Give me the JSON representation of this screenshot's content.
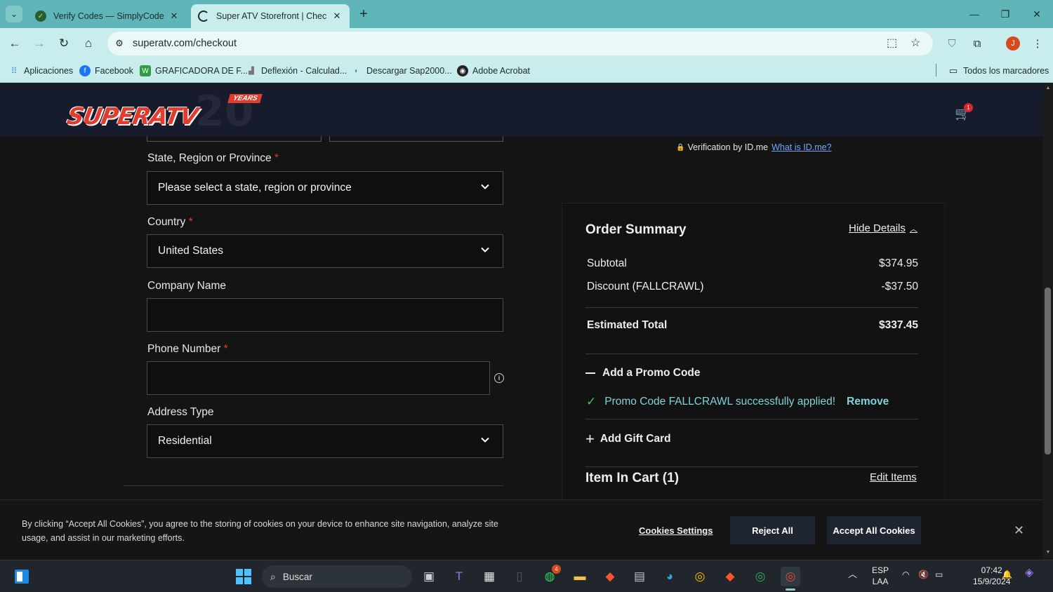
{
  "browser": {
    "tabs": [
      {
        "title": "Verify Codes — SimplyCodes",
        "active": false
      },
      {
        "title": "Super ATV Storefront | Checkou",
        "active": true
      }
    ],
    "new_tab": "+",
    "url": "superatv.com/checkout",
    "bookmarks": [
      {
        "label": "Aplicaciones",
        "icon": "apps-grid-icon",
        "color": "#4285f4"
      },
      {
        "label": "Facebook",
        "icon": "facebook-icon",
        "color": "#1877f2"
      },
      {
        "label": "GRAFICADORA DE F...",
        "icon": "graph-icon",
        "color": "#2e9c40"
      },
      {
        "label": "Deflexión - Calculad...",
        "icon": "beam-icon",
        "color": "#777777"
      },
      {
        "label": "Descargar Sap2000...",
        "icon": "download-icon",
        "color": "#3a86c8"
      },
      {
        "label": "Adobe Acrobat",
        "icon": "acrobat-icon",
        "color": "#222222"
      }
    ],
    "all_bookmarks": "Todos los marcadores",
    "profile_initial": "J"
  },
  "site": {
    "logo_text": "SUPERATV",
    "logo_anniversary": "20",
    "logo_years": "YEARS",
    "cart_count": "1"
  },
  "form": {
    "state_label": "State, Region or Province",
    "state_value": "Please select a state, region or province",
    "country_label": "Country",
    "country_value": "United States",
    "company_label": "Company Name",
    "company_value": "",
    "phone_label": "Phone Number",
    "phone_value": "",
    "address_type_label": "Address Type",
    "address_type_value": "Residential",
    "required_mark": "*"
  },
  "verification": {
    "text": "Verification by ID.me",
    "link": "What is ID.me?"
  },
  "summary": {
    "title": "Order Summary",
    "hide_details": "Hide Details",
    "subtotal_label": "Subtotal",
    "subtotal_value": "$374.95",
    "discount_label": "Discount (FALLCRAWL)",
    "discount_value": "-$37.50",
    "total_label": "Estimated Total",
    "total_value": "$337.45",
    "promo_heading": "Add a Promo Code",
    "promo_success": "Promo Code FALLCRAWL successfully applied!",
    "promo_remove": "Remove",
    "gift_card": "Add Gift Card",
    "items_title": "Item In Cart (1)",
    "edit_items": "Edit Items"
  },
  "cookie": {
    "text": "By clicking “Accept All Cookies”, you agree to the storing of cookies on your device to enhance site navigation, analyze site usage, and assist in our marketing efforts.",
    "settings": "Cookies Settings",
    "reject": "Reject All",
    "accept": "Accept All Cookies"
  },
  "taskbar": {
    "search": "Buscar",
    "lang_top": "ESP",
    "lang_bottom": "LAA",
    "time": "07:42",
    "date": "15/9/2024",
    "whatsapp_badge": "4"
  },
  "colors": {
    "accent_teal": "#7fd3d8",
    "required_red": "#e33b2e",
    "chrome_teal": "#5fb5b8",
    "success_green": "#4bbf6b"
  }
}
